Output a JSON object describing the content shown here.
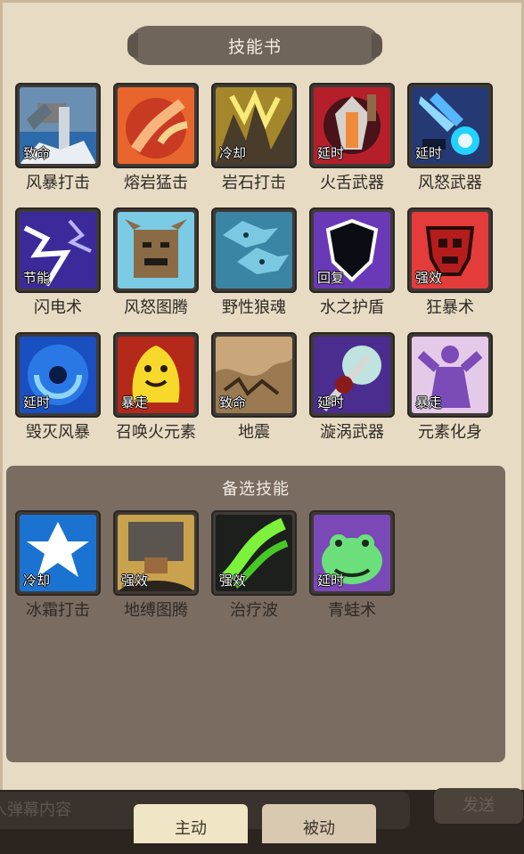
{
  "title": "技能书",
  "skills": [
    {
      "name": "风暴打击",
      "tag": "致命",
      "icon": "storm-strike-icon"
    },
    {
      "name": "熔岩猛击",
      "tag": "",
      "icon": "lava-lash-icon"
    },
    {
      "name": "岩石打击",
      "tag": "冷却",
      "icon": "rock-strike-icon"
    },
    {
      "name": "火舌武器",
      "tag": "延时",
      "icon": "flametongue-weapon-icon"
    },
    {
      "name": "风怒武器",
      "tag": "延时",
      "icon": "windfury-weapon-icon"
    },
    {
      "name": "闪电术",
      "tag": "节能",
      "icon": "lightning-bolt-icon"
    },
    {
      "name": "风怒图腾",
      "tag": "",
      "icon": "windfury-totem-icon"
    },
    {
      "name": "野性狼魂",
      "tag": "",
      "icon": "feral-spirit-icon"
    },
    {
      "name": "水之护盾",
      "tag": "回复",
      "icon": "water-shield-icon"
    },
    {
      "name": "狂暴术",
      "tag": "强效",
      "icon": "bloodlust-icon"
    },
    {
      "name": "毁灭风暴",
      "tag": "延时",
      "icon": "doom-storm-icon"
    },
    {
      "name": "召唤火元素",
      "tag": "暴走",
      "icon": "fire-elemental-icon"
    },
    {
      "name": "地震",
      "tag": "致命",
      "icon": "earthquake-icon"
    },
    {
      "name": "漩涡武器",
      "tag": "延时",
      "icon": "maelstrom-weapon-icon"
    },
    {
      "name": "元素化身",
      "tag": "暴走",
      "icon": "elemental-avatar-icon"
    }
  ],
  "backup_title": "备选技能",
  "backup_skills": [
    {
      "name": "冰霜打击",
      "tag": "冷却",
      "icon": "frost-strike-icon"
    },
    {
      "name": "地缚图腾",
      "tag": "强效",
      "icon": "earthbind-totem-icon"
    },
    {
      "name": "治疗波",
      "tag": "强效",
      "icon": "healing-wave-icon"
    },
    {
      "name": "青蛙术",
      "tag": "延时",
      "icon": "hex-frog-icon"
    }
  ],
  "bottom": {
    "danmu_placeholder": "输入弹幕内容",
    "danmu_visible": "入弹幕内容",
    "send": "发送",
    "send_visible": "发送",
    "tab_active": "主动",
    "tab_inactive": "被动"
  }
}
